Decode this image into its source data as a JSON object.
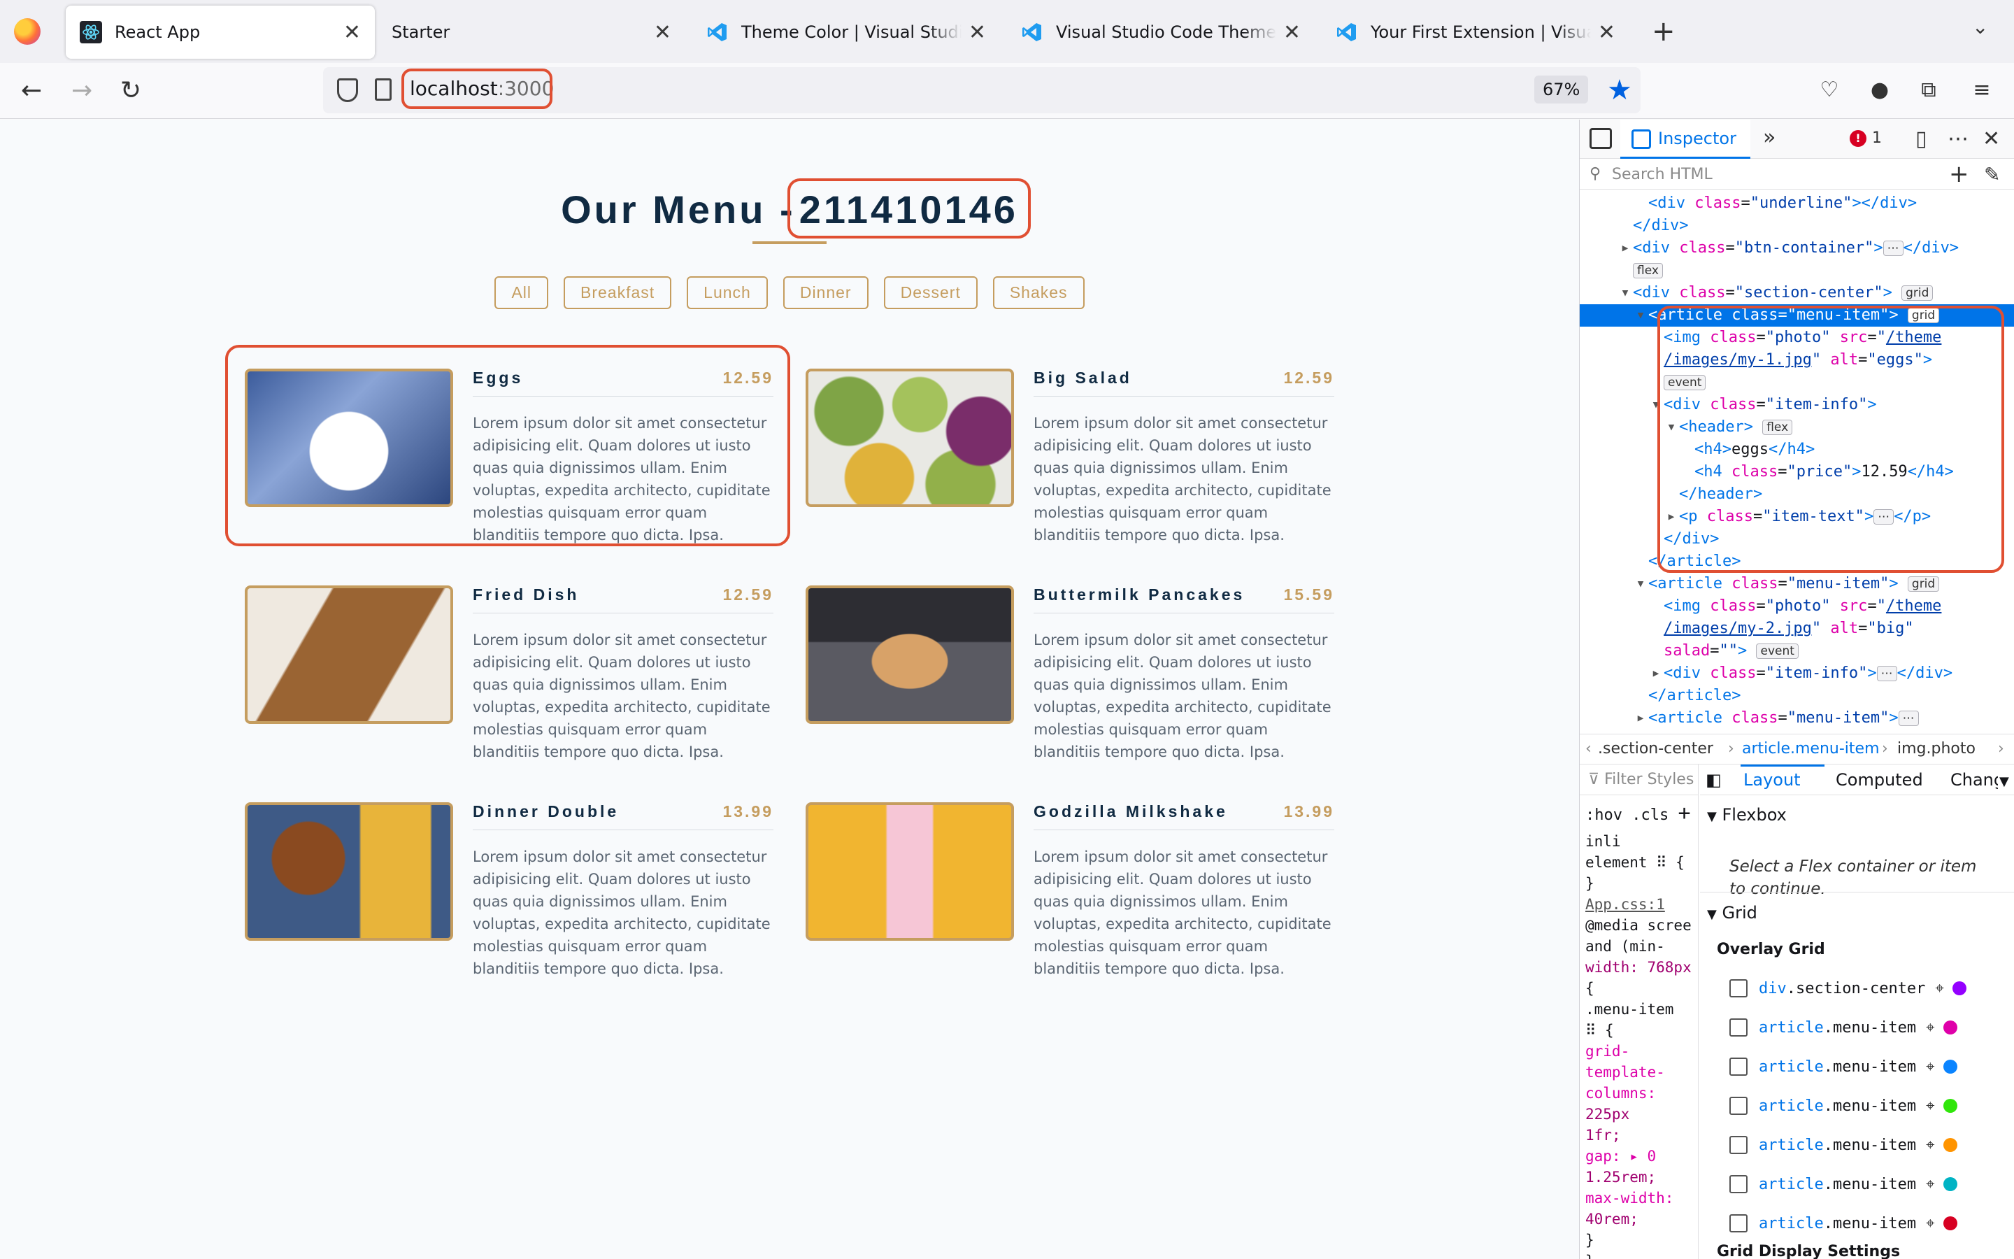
{
  "tabs": [
    {
      "label": "React App",
      "icon": "react-icon",
      "active": true
    },
    {
      "label": "Starter",
      "icon": "none",
      "active": false
    },
    {
      "label": "Theme Color | Visual Studio Code",
      "icon": "vscode-icon",
      "active": false
    },
    {
      "label": "Visual Studio Code Themes",
      "icon": "vscode-icon",
      "active": false
    },
    {
      "label": "Your First Extension | Visual Studio Code",
      "icon": "vscode-icon",
      "active": false
    }
  ],
  "nav": {
    "url_host": "localhost",
    "url_port": ":3000",
    "zoom": "67%",
    "bookmarked": true,
    "glyphs": {
      "back": "←",
      "forward": "→",
      "reload": "↻",
      "new_tab": "+",
      "list_tabs": "⌄",
      "close": "✕",
      "star": "★",
      "pocket": "♡",
      "account": "●",
      "extensions": "⧉",
      "menu": "≡"
    }
  },
  "page": {
    "title_prefix": "Our Menu -",
    "title_number": "211410146",
    "filters": [
      "All",
      "Breakfast",
      "Lunch",
      "Dinner",
      "Dessert",
      "Shakes"
    ],
    "items": [
      {
        "name": "Eggs",
        "price": "12.59",
        "photo": "ph-eggs",
        "text": "Lorem ipsum dolor sit amet consectetur adipisicing elit. Quam dolores ut iusto quas quia dignissimos ullam. Enim voluptas, expedita architecto, cupiditate molestias quisquam error quam blanditiis tempore quo dicta. Ipsa."
      },
      {
        "name": "Big Salad",
        "price": "12.59",
        "photo": "ph-salad",
        "text": "Lorem ipsum dolor sit amet consectetur adipisicing elit. Quam dolores ut iusto quas quia dignissimos ullam. Enim voluptas, expedita architecto, cupiditate molestias quisquam error quam blanditiis tempore quo dicta. Ipsa."
      },
      {
        "name": "Fried Dish",
        "price": "12.59",
        "photo": "ph-fried",
        "text": "Lorem ipsum dolor sit amet consectetur adipisicing elit. Quam dolores ut iusto quas quia dignissimos ullam. Enim voluptas, expedita architecto, cupiditate molestias quisquam error quam blanditiis tempore quo dicta. Ipsa."
      },
      {
        "name": "Buttermilk Pancakes",
        "price": "15.59",
        "photo": "ph-pancake",
        "text": "Lorem ipsum dolor sit amet consectetur adipisicing elit. Quam dolores ut iusto quas quia dignissimos ullam. Enim voluptas, expedita architecto, cupiditate molestias quisquam error quam blanditiis tempore quo dicta. Ipsa."
      },
      {
        "name": "Dinner Double",
        "price": "13.99",
        "photo": "ph-burger",
        "text": "Lorem ipsum dolor sit amet consectetur adipisicing elit. Quam dolores ut iusto quas quia dignissimos ullam. Enim voluptas, expedita architecto, cupiditate molestias quisquam error quam blanditiis tempore quo dicta. Ipsa."
      },
      {
        "name": "Godzilla Milkshake",
        "price": "13.99",
        "photo": "ph-shake",
        "text": "Lorem ipsum dolor sit amet consectetur adipisicing elit. Quam dolores ut iusto quas quia dignissimos ullam. Enim voluptas, expedita architecto, cupiditate molestias quisquam error quam blanditiis tempore quo dicta. Ipsa."
      }
    ]
  },
  "devtools": {
    "active_tab": "Inspector",
    "error_count": "1",
    "search_placeholder": "Search HTML",
    "tree": [
      {
        "indent": 3,
        "tw": "",
        "html": "<span class='tag'>&lt;div</span> <span class='attr'>class</span>=<span class='val'>\"underline\"</span><span class='tag'>&gt;&lt;/div&gt;</span>"
      },
      {
        "indent": 2,
        "tw": "",
        "html": "<span class='tag'>&lt;/div&gt;</span>"
      },
      {
        "indent": 2,
        "tw": "▸",
        "html": "<span class='tag'>&lt;div</span> <span class='attr'>class</span>=<span class='val'>\"btn-container\"</span><span class='tag'>&gt;</span><span class='badge'>⋯</span><span class='tag'>&lt;/div&gt;</span>"
      },
      {
        "indent": 2,
        "tw": "",
        "html": "<span class='badge'>flex</span>"
      },
      {
        "indent": 2,
        "tw": "▾",
        "html": "<span class='tag'>&lt;div</span> <span class='attr'>class</span>=<span class='val'>\"section-center\"</span><span class='tag'>&gt;</span> <span class='badge'>grid</span>"
      },
      {
        "indent": 3,
        "tw": "▾",
        "sel": true,
        "html": "<span class='tag'>&lt;article</span> <span class='attr'>class</span>=<span class='val'>\"menu-item\"</span><span class='tag'>&gt;</span> <span class='badge'>grid</span>"
      },
      {
        "indent": 4,
        "tw": "",
        "html": "<span class='tag'>&lt;img</span> <span class='attr'>class</span>=<span class='val'>\"photo\"</span> <span class='attr'>src</span>=<span class='val'>\"<span class='lnk'>/theme</span></span>"
      },
      {
        "indent": 4,
        "tw": "",
        "html": "<span class='val'><span class='lnk'>/images/my-1.jpg</span>\"</span> <span class='attr'>alt</span>=<span class='val'>\"eggs\"</span><span class='tag'>&gt;</span>"
      },
      {
        "indent": 4,
        "tw": "",
        "html": "<span class='badge'>event</span>"
      },
      {
        "indent": 4,
        "tw": "▾",
        "html": "<span class='tag'>&lt;div</span> <span class='attr'>class</span>=<span class='val'>\"item-info\"</span><span class='tag'>&gt;</span>"
      },
      {
        "indent": 5,
        "tw": "▾",
        "html": "<span class='tag'>&lt;header&gt;</span> <span class='badge'>flex</span>"
      },
      {
        "indent": 6,
        "tw": "",
        "html": "<span class='tag'>&lt;h4&gt;</span>eggs<span class='tag'>&lt;/h4&gt;</span>"
      },
      {
        "indent": 6,
        "tw": "",
        "html": "<span class='tag'>&lt;h4</span> <span class='attr'>class</span>=<span class='val'>\"price\"</span><span class='tag'>&gt;</span>12.59<span class='tag'>&lt;/h4&gt;</span>"
      },
      {
        "indent": 5,
        "tw": "",
        "html": "<span class='tag'>&lt;/header&gt;</span>"
      },
      {
        "indent": 5,
        "tw": "▸",
        "html": "<span class='tag'>&lt;p</span> <span class='attr'>class</span>=<span class='val'>\"item-text\"</span><span class='tag'>&gt;</span><span class='badge'>⋯</span><span class='tag'>&lt;/p&gt;</span>"
      },
      {
        "indent": 4,
        "tw": "",
        "html": "<span class='tag'>&lt;/div&gt;</span>"
      },
      {
        "indent": 3,
        "tw": "",
        "html": "<span class='tag'>&lt;/article&gt;</span>"
      },
      {
        "indent": 3,
        "tw": "▾",
        "html": "<span class='tag'>&lt;article</span> <span class='attr'>class</span>=<span class='val'>\"menu-item\"</span><span class='tag'>&gt;</span> <span class='badge'>grid</span>"
      },
      {
        "indent": 4,
        "tw": "",
        "html": "<span class='tag'>&lt;img</span> <span class='attr'>class</span>=<span class='val'>\"photo\"</span> <span class='attr'>src</span>=<span class='val'>\"<span class='lnk'>/theme</span></span>"
      },
      {
        "indent": 4,
        "tw": "",
        "html": "<span class='val'><span class='lnk'>/images/my-2.jpg</span>\"</span> <span class='attr'>alt</span>=<span class='val'>\"big\"</span>"
      },
      {
        "indent": 4,
        "tw": "",
        "html": "<span class='attr'>salad</span>=<span class='val'>\"\"</span><span class='tag'>&gt;</span> <span class='badge'>event</span>"
      },
      {
        "indent": 4,
        "tw": "▸",
        "html": "<span class='tag'>&lt;div</span> <span class='attr'>class</span>=<span class='val'>\"item-info\"</span><span class='tag'>&gt;</span><span class='badge'>⋯</span><span class='tag'>&lt;/div&gt;</span>"
      },
      {
        "indent": 3,
        "tw": "",
        "html": "<span class='tag'>&lt;/article&gt;</span>"
      },
      {
        "indent": 3,
        "tw": "▸",
        "html": "<span class='tag'>&lt;article</span> <span class='attr'>class</span>=<span class='val'>\"menu-item\"</span><span class='tag'>&gt;</span><span class='badge'>⋯</span>"
      }
    ],
    "breadcrumbs": [
      ".section-center",
      "article.menu-item",
      "img.photo"
    ],
    "rules_filter": "Filter Styles",
    "rules_hov": ":hov .cls",
    "rules_lines": [
      "inli",
      "element ⠿ {",
      "}",
      "App.css:1",
      "@media scree",
      "and (min-",
      "width: 768px",
      "{",
      " .menu-item",
      " ⠿ {",
      "  grid-",
      "  template-",
      "  columns:",
      "  225px",
      "  1fr;",
      "  gap: ▸ 0",
      "  1.25rem;",
      "  max-width:",
      "  40rem;",
      " }",
      "}"
    ],
    "layout_tabs": [
      "Layout",
      "Computed",
      "Changes"
    ],
    "flexbox_title": "Flexbox",
    "flexbox_msg": "Select a Flex container or item to continue.",
    "grid_title": "Grid",
    "overlay_title": "Overlay Grid",
    "grid_display_title": "Grid Display Settings",
    "overlay_items": [
      {
        "tag": "div",
        "cls": ".section-center",
        "color": "#9400ff"
      },
      {
        "tag": "article",
        "cls": ".menu-item",
        "color": "#df00a9"
      },
      {
        "tag": "article",
        "cls": ".menu-item",
        "color": "#0a84ff"
      },
      {
        "tag": "article",
        "cls": ".menu-item",
        "color": "#30e60b"
      },
      {
        "tag": "article",
        "cls": ".menu-item",
        "color": "#ff9400"
      },
      {
        "tag": "article",
        "cls": ".menu-item",
        "color": "#00b3c4"
      },
      {
        "tag": "article",
        "cls": ".menu-item",
        "color": "#d70022"
      }
    ]
  }
}
